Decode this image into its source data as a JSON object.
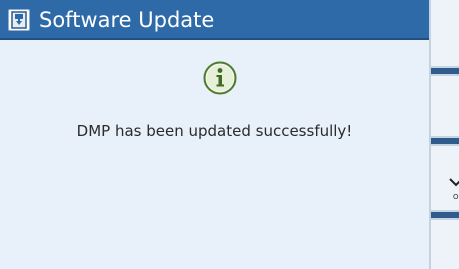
{
  "dialog": {
    "title": "Software Update",
    "message": "DMP has been updated successfully!"
  },
  "right_panel": {
    "confirm_label": "OK"
  },
  "colors": {
    "title_bar": "#2f6aa8",
    "dialog_background": "#e8f0f9",
    "info_icon": "#5a8a3a",
    "accent_bar": "#2f5c8c"
  },
  "icons": {
    "title_icon": "software-update-icon",
    "message_icon": "info-icon",
    "confirm_icon": "check-chevron-icon"
  }
}
